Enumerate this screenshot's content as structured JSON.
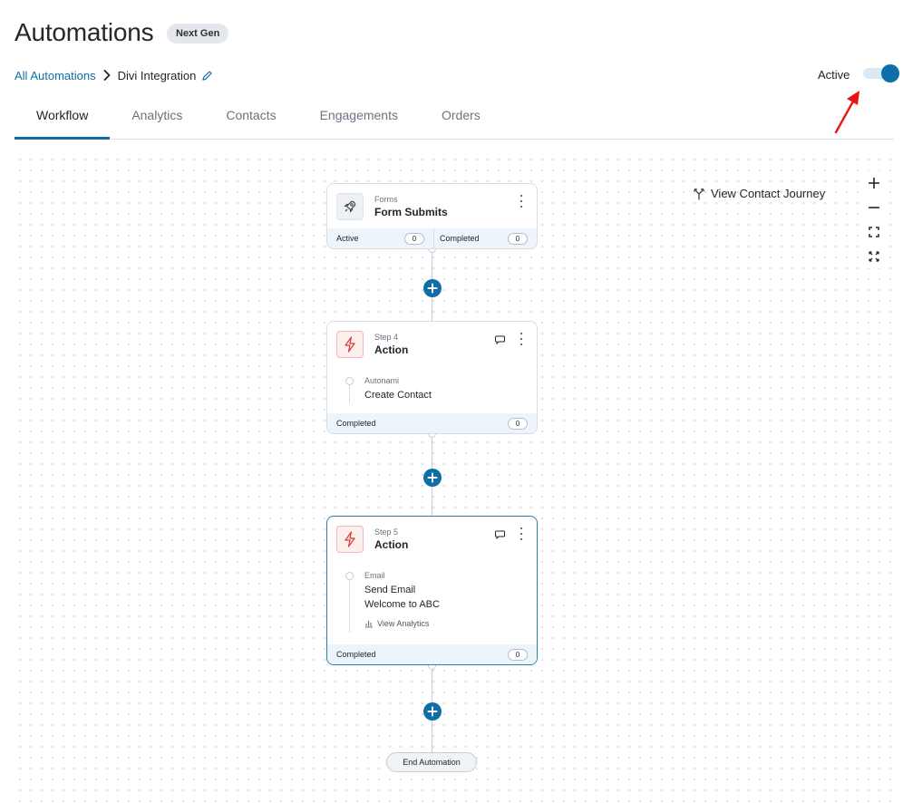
{
  "header": {
    "title": "Automations",
    "badge": "Next Gen"
  },
  "breadcrumb": {
    "root": "All Automations",
    "current": "Divi Integration"
  },
  "status": {
    "label": "Active",
    "enabled": true,
    "accent": "#0f6ea8"
  },
  "tabs": [
    {
      "label": "Workflow",
      "active": true
    },
    {
      "label": "Analytics",
      "active": false
    },
    {
      "label": "Contacts",
      "active": false
    },
    {
      "label": "Engagements",
      "active": false
    },
    {
      "label": "Orders",
      "active": false
    }
  ],
  "canvas": {
    "journey_label": "View Contact Journey",
    "zoom_controls": [
      "plus-icon",
      "minus-icon",
      "fit-view-icon",
      "fullscreen-icon"
    ]
  },
  "nodes": {
    "trigger": {
      "icon": "rocket-icon",
      "subtitle": "Forms",
      "title": "Form Submits",
      "active_label": "Active",
      "active_count": "0",
      "completed_label": "Completed",
      "completed_count": "0"
    },
    "step4": {
      "icon": "lightning-icon",
      "subtitle": "Step 4",
      "title": "Action",
      "kind": "Autonami",
      "action": "Create Contact",
      "completed_label": "Completed",
      "completed_count": "0"
    },
    "step5": {
      "icon": "lightning-icon",
      "subtitle": "Step 5",
      "title": "Action",
      "kind": "Email",
      "action": "Send Email",
      "detail": "Welcome to ABC",
      "analytics_link": "View Analytics",
      "completed_label": "Completed",
      "completed_count": "0"
    }
  },
  "end_label": "End Automation"
}
